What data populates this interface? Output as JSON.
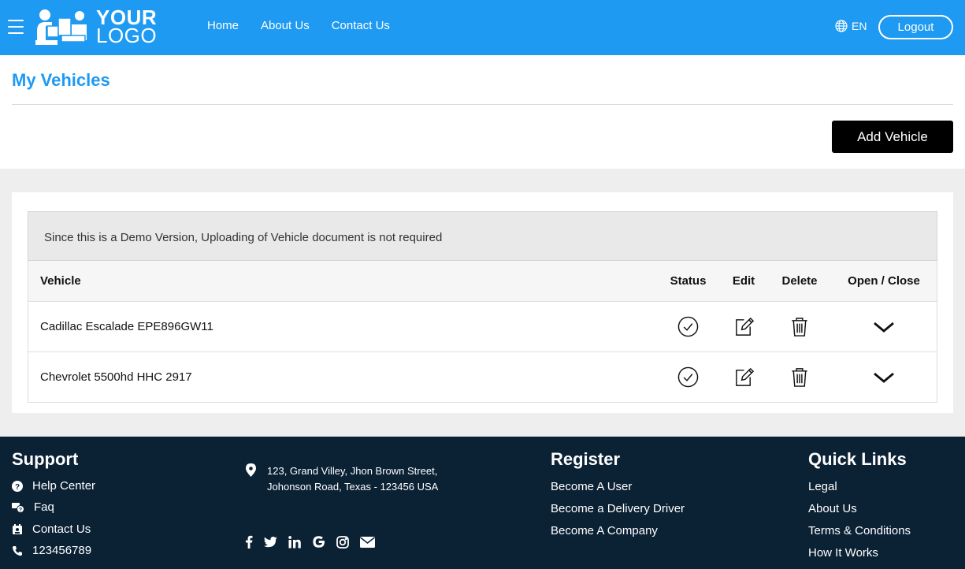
{
  "header": {
    "logo_line1": "YOUR",
    "logo_line2": "LOGO",
    "nav": [
      "Home",
      "About Us",
      "Contact Us"
    ],
    "language": "EN",
    "logout_label": "Logout",
    "bg_color": "#1e9af2"
  },
  "page": {
    "title": "My Vehicles",
    "add_label": "Add Vehicle",
    "notice": "Since this is a Demo Version, Uploading of Vehicle document is not required"
  },
  "table": {
    "columns": [
      "Vehicle",
      "Status",
      "Edit",
      "Delete",
      "Open / Close"
    ],
    "rows": [
      {
        "vehicle": "Cadillac Escalade EPE896GW11",
        "status_icon": "check-circle-icon",
        "edit_icon": "edit-icon",
        "delete_icon": "trash-icon",
        "toggle_icon": "chevron-down-icon"
      },
      {
        "vehicle": "Chevrolet 5500hd HHC 2917",
        "status_icon": "check-circle-icon",
        "edit_icon": "edit-icon",
        "delete_icon": "trash-icon",
        "toggle_icon": "chevron-down-icon"
      }
    ]
  },
  "footer": {
    "support": {
      "title": "Support",
      "items": [
        "Help Center",
        "Faq",
        "Contact Us",
        "123456789"
      ]
    },
    "address": {
      "line1": "123, Grand Villey, Jhon Brown Street,",
      "line2": "Johonson Road, Texas - 123456 USA"
    },
    "social": [
      "facebook-icon",
      "twitter-icon",
      "linkedin-icon",
      "google-icon",
      "instagram-icon",
      "email-icon"
    ],
    "register": {
      "title": "Register",
      "items": [
        "Become A User",
        "Become a Delivery Driver",
        "Become A Company"
      ]
    },
    "quick_links": {
      "title": "Quick Links",
      "items": [
        "Legal",
        "About Us",
        "Terms & Conditions",
        "How It Works"
      ]
    },
    "bg_color": "#0b2134"
  }
}
